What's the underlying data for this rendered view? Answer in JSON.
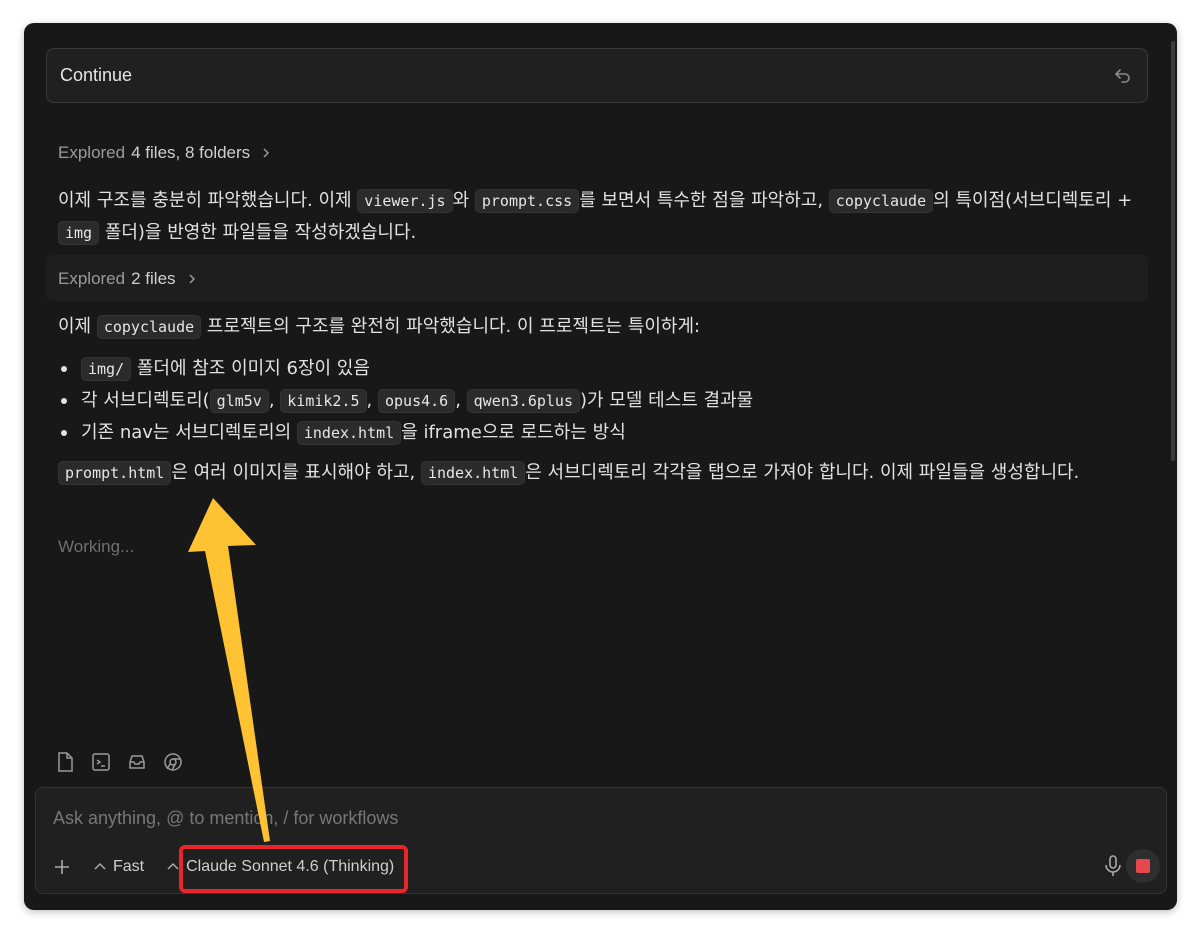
{
  "user_message": {
    "text": "Continue"
  },
  "explored_1": {
    "prefix": "Explored",
    "count": "4 files, 8 folders"
  },
  "para_1": {
    "t1": "이제 구조를 충분히 파악했습니다. 이제 ",
    "c1": "viewer.js",
    "t2": "와 ",
    "c2": "prompt.css",
    "t3": "를 보면서 특수한 점을 파악하고, ",
    "c3": "copyclaude",
    "t4": "의 특이점(서브디렉토리 + ",
    "c4": "img",
    "t5": " 폴더)을 반영한 파일들을 작성하겠습니다."
  },
  "explored_2": {
    "prefix": "Explored",
    "count": "2 files"
  },
  "para_2": {
    "t1": "이제 ",
    "c1": "copyclaude",
    "t2": " 프로젝트의 구조를 완전히 파악했습니다. 이 프로젝트는 특이하게:"
  },
  "bullets": {
    "b1_c1": "img/",
    "b1_t1": " 폴더에 참조 이미지 6장이 있음",
    "b2_t1": "각 서브디렉토리(",
    "b2_c1": "glm5v",
    "b2_c2": "kimik2.5",
    "b2_c3": "opus4.6",
    "b2_c4": "qwen3.6plus",
    "b2_t2": ")가 모델 테스트 결과물",
    "b3_t1": "기존 nav는 서브디렉토리의 ",
    "b3_c1": "index.html",
    "b3_t2": "을 iframe으로 로드하는 방식"
  },
  "para_3": {
    "c1": "prompt.html",
    "t1": "은 여러 이미지를 표시해야 하고, ",
    "c2": "index.html",
    "t2": "은 서브디렉토리 각각을 탭으로 가져야 합니다. 이제 파일들을 생성합니다."
  },
  "status": {
    "working": "Working..."
  },
  "composer": {
    "placeholder": "Ask anything, @ to mention, / for workflows",
    "mode_label": "Fast",
    "model_label": "Claude Sonnet 4.6 (Thinking)"
  },
  "colors": {
    "highlight": "#e8262a",
    "arrow": "#ffc233",
    "stop": "#e5484d"
  }
}
